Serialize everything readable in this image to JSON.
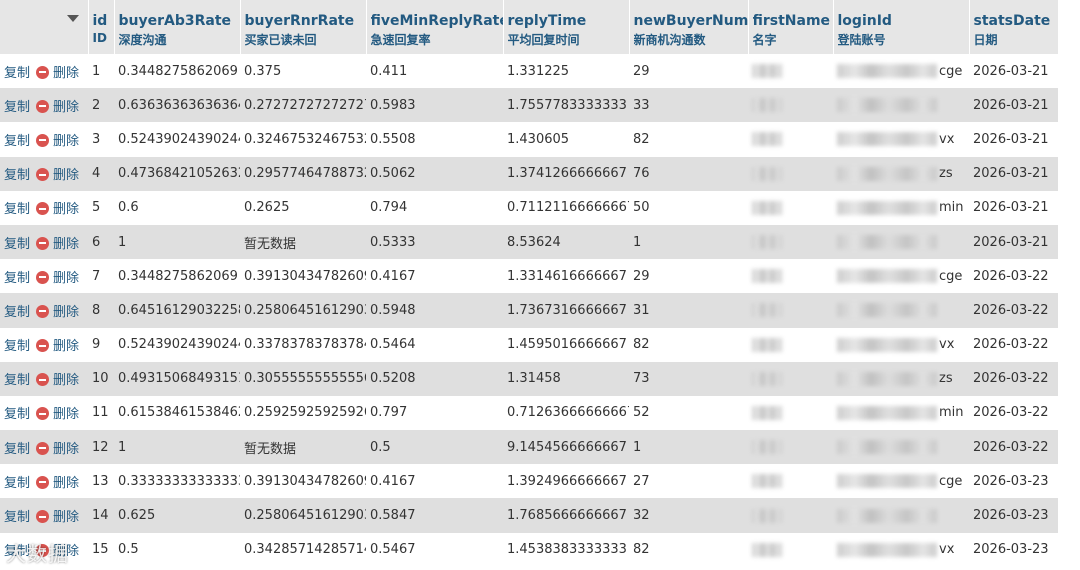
{
  "actions": {
    "copy_label": "复制",
    "delete_label": "删除"
  },
  "columns": [
    {
      "name": "id",
      "comment": "ID"
    },
    {
      "name": "buyerAb3Rate",
      "comment": "深度沟通"
    },
    {
      "name": "buyerRnrRate",
      "comment": "买家已读未回"
    },
    {
      "name": "fiveMinReplyRate",
      "comment": "急速回复率"
    },
    {
      "name": "replyTime",
      "comment": "平均回复时间"
    },
    {
      "name": "newBuyerNum",
      "comment": "新商机沟通数"
    },
    {
      "name": "firstName",
      "comment": "名字"
    },
    {
      "name": "loginId",
      "comment": "登陆账号"
    },
    {
      "name": "statsDate",
      "comment": "日期"
    }
  ],
  "rows": [
    {
      "id": "1",
      "buyerAb3Rate": "0.3448275862069",
      "buyerRnrRate": "0.375",
      "fiveMinReplyRate": "0.411",
      "replyTime": "1.331225",
      "newBuyerNum": "29",
      "loginIdTail": "cge",
      "statsDate": "2026-03-21"
    },
    {
      "id": "2",
      "buyerAb3Rate": "0.63636363636364",
      "buyerRnrRate": "0.27272727272727",
      "fiveMinReplyRate": "0.5983",
      "replyTime": "1.7557783333333",
      "newBuyerNum": "33",
      "loginIdTail": "",
      "statsDate": "2026-03-21"
    },
    {
      "id": "3",
      "buyerAb3Rate": "0.52439024390244",
      "buyerRnrRate": "0.32467532467532",
      "fiveMinReplyRate": "0.5508",
      "replyTime": "1.430605",
      "newBuyerNum": "82",
      "loginIdTail": "vx",
      "statsDate": "2026-03-21"
    },
    {
      "id": "4",
      "buyerAb3Rate": "0.47368421052632",
      "buyerRnrRate": "0.29577464788732",
      "fiveMinReplyRate": "0.5062",
      "replyTime": "1.3741266666667",
      "newBuyerNum": "76",
      "loginIdTail": "zs",
      "statsDate": "2026-03-21"
    },
    {
      "id": "5",
      "buyerAb3Rate": "0.6",
      "buyerRnrRate": "0.2625",
      "fiveMinReplyRate": "0.794",
      "replyTime": "0.71121166666667",
      "newBuyerNum": "50",
      "loginIdTail": "min",
      "statsDate": "2026-03-21"
    },
    {
      "id": "6",
      "buyerAb3Rate": "1",
      "buyerRnrRate": "暂无数据",
      "fiveMinReplyRate": "0.5333",
      "replyTime": "8.53624",
      "newBuyerNum": "1",
      "loginIdTail": "",
      "statsDate": "2026-03-21"
    },
    {
      "id": "7",
      "buyerAb3Rate": "0.3448275862069",
      "buyerRnrRate": "0.39130434782609",
      "fiveMinReplyRate": "0.4167",
      "replyTime": "1.3314616666667",
      "newBuyerNum": "29",
      "loginIdTail": "cge",
      "statsDate": "2026-03-22"
    },
    {
      "id": "8",
      "buyerAb3Rate": "0.64516129032258",
      "buyerRnrRate": "0.25806451612903",
      "fiveMinReplyRate": "0.5948",
      "replyTime": "1.7367316666667",
      "newBuyerNum": "31",
      "loginIdTail": "",
      "statsDate": "2026-03-22"
    },
    {
      "id": "9",
      "buyerAb3Rate": "0.52439024390244",
      "buyerRnrRate": "0.33783783783784",
      "fiveMinReplyRate": "0.5464",
      "replyTime": "1.4595016666667",
      "newBuyerNum": "82",
      "loginIdTail": "vx",
      "statsDate": "2026-03-22"
    },
    {
      "id": "10",
      "buyerAb3Rate": "0.49315068493151",
      "buyerRnrRate": "0.30555555555556",
      "fiveMinReplyRate": "0.5208",
      "replyTime": "1.31458",
      "newBuyerNum": "73",
      "loginIdTail": "zs",
      "statsDate": "2026-03-22"
    },
    {
      "id": "11",
      "buyerAb3Rate": "0.61538461538462",
      "buyerRnrRate": "0.25925925925926",
      "fiveMinReplyRate": "0.797",
      "replyTime": "0.71263666666667",
      "newBuyerNum": "52",
      "loginIdTail": "min",
      "statsDate": "2026-03-22"
    },
    {
      "id": "12",
      "buyerAb3Rate": "1",
      "buyerRnrRate": "暂无数据",
      "fiveMinReplyRate": "0.5",
      "replyTime": "9.1454566666667",
      "newBuyerNum": "1",
      "loginIdTail": "",
      "statsDate": "2026-03-22"
    },
    {
      "id": "13",
      "buyerAb3Rate": "0.33333333333333",
      "buyerRnrRate": "0.39130434782609",
      "fiveMinReplyRate": "0.4167",
      "replyTime": "1.3924966666667",
      "newBuyerNum": "27",
      "loginIdTail": "cge",
      "statsDate": "2026-03-23"
    },
    {
      "id": "14",
      "buyerAb3Rate": "0.625",
      "buyerRnrRate": "0.25806451612903",
      "fiveMinReplyRate": "0.5847",
      "replyTime": "1.7685666666667",
      "newBuyerNum": "32",
      "loginIdTail": "",
      "statsDate": "2026-03-23"
    },
    {
      "id": "15",
      "buyerAb3Rate": "0.5",
      "buyerRnrRate": "0.34285714285714",
      "fiveMinReplyRate": "0.5467",
      "replyTime": "1.4538383333333",
      "newBuyerNum": "82",
      "loginIdTail": "vx",
      "statsDate": "2026-03-23"
    }
  ],
  "watermark": "大数据"
}
